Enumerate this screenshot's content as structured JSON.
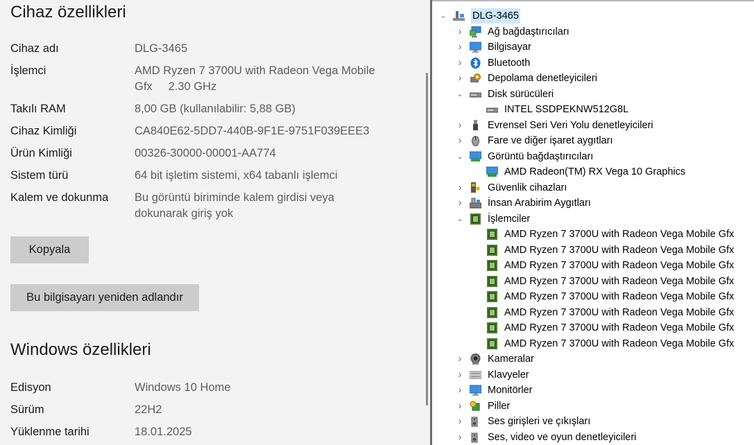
{
  "device_specs": {
    "title": "Cihaz özellikleri",
    "rows": [
      {
        "key": "Cihaz adı",
        "value": "DLG-3465"
      },
      {
        "key": "İşlemci",
        "value": "AMD Ryzen 7 3700U with Radeon Vega Mobile Gfx     2.30 GHz"
      },
      {
        "key": "Takılı RAM",
        "value": "8,00 GB (kullanılabilir: 5,88 GB)"
      },
      {
        "key": "Cihaz Kimliği",
        "value": "CA840E62-5DD7-440B-9F1E-9751F039EEE3"
      },
      {
        "key": "Ürün Kimliği",
        "value": "00326-30000-00001-AA774"
      },
      {
        "key": "Sistem türü",
        "value": "64 bit işletim sistemi, x64 tabanlı işlemci"
      },
      {
        "key": "Kalem ve dokunma",
        "value": "Bu görüntü biriminde kalem girdisi veya dokunarak giriş yok"
      }
    ],
    "copy_button": "Kopyala",
    "rename_button": "Bu bilgisayarı yeniden adlandır"
  },
  "windows_specs": {
    "title": "Windows özellikleri",
    "rows": [
      {
        "key": "Edisyon",
        "value": "Windows 10 Home"
      },
      {
        "key": "Sürüm",
        "value": "22H2"
      },
      {
        "key": "Yüklenme tarihi",
        "value": "18.01.2025"
      }
    ]
  },
  "device_manager": {
    "root": "DLG-3465",
    "categories": [
      {
        "label": "Ağ bağdaştırıcıları",
        "icon": "network-icon",
        "expanded": false
      },
      {
        "label": "Bilgisayar",
        "icon": "monitor-icon",
        "expanded": false
      },
      {
        "label": "Bluetooth",
        "icon": "bluetooth-icon",
        "expanded": false
      },
      {
        "label": "Depolama denetleyicileri",
        "icon": "storage-controller-icon",
        "expanded": false
      },
      {
        "label": "Disk sürücüleri",
        "icon": "disk-icon",
        "expanded": true,
        "children": [
          "INTEL SSDPEKNW512G8L"
        ]
      },
      {
        "label": "Evrensel Seri Veri Yolu denetleyicileri",
        "icon": "usb-icon",
        "expanded": false
      },
      {
        "label": "Fare ve diğer işaret aygıtları",
        "icon": "mouse-icon",
        "expanded": false
      },
      {
        "label": "Görüntü bağdaştırıcıları",
        "icon": "display-adapter-icon",
        "expanded": true,
        "children": [
          "AMD Radeon(TM) RX Vega 10 Graphics"
        ]
      },
      {
        "label": "Güvenlik cihazları",
        "icon": "security-device-icon",
        "expanded": false
      },
      {
        "label": "İnsan Arabirim Aygıtları",
        "icon": "hid-icon",
        "expanded": false
      },
      {
        "label": "İşlemciler",
        "icon": "cpu-icon",
        "expanded": true,
        "children": [
          "AMD Ryzen 7 3700U with Radeon Vega Mobile Gfx",
          "AMD Ryzen 7 3700U with Radeon Vega Mobile Gfx",
          "AMD Ryzen 7 3700U with Radeon Vega Mobile Gfx",
          "AMD Ryzen 7 3700U with Radeon Vega Mobile Gfx",
          "AMD Ryzen 7 3700U with Radeon Vega Mobile Gfx",
          "AMD Ryzen 7 3700U with Radeon Vega Mobile Gfx",
          "AMD Ryzen 7 3700U with Radeon Vega Mobile Gfx",
          "AMD Ryzen 7 3700U with Radeon Vega Mobile Gfx"
        ]
      },
      {
        "label": "Kameralar",
        "icon": "camera-icon",
        "expanded": false
      },
      {
        "label": "Klavyeler",
        "icon": "keyboard-icon",
        "expanded": false
      },
      {
        "label": "Monitörler",
        "icon": "monitor-icon",
        "expanded": false
      },
      {
        "label": "Piller",
        "icon": "battery-icon",
        "expanded": false
      },
      {
        "label": "Ses girişleri ve çıkışları",
        "icon": "speaker-icon",
        "expanded": false
      },
      {
        "label": "Ses, video ve oyun denetleyicileri",
        "icon": "speaker-icon",
        "expanded": false
      }
    ]
  }
}
